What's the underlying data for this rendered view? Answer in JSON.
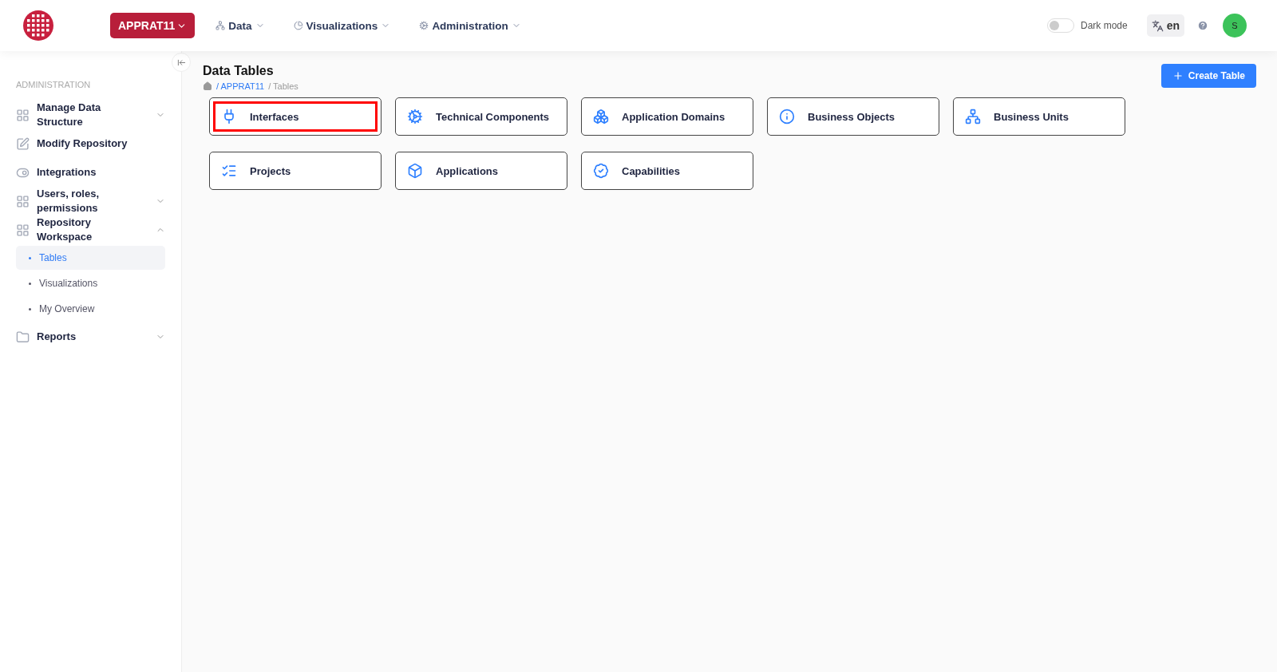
{
  "header": {
    "workspace": "APPRAT11",
    "menus": [
      {
        "label": "Data"
      },
      {
        "label": "Visualizations"
      },
      {
        "label": "Administration"
      }
    ],
    "dark_mode": {
      "label": "Dark mode",
      "on": false
    },
    "language": "en",
    "avatar": "S"
  },
  "sidebar": {
    "section": "ADMINISTRATION",
    "items": [
      {
        "label": "Manage Data Structure",
        "kind": "group",
        "expanded": false
      },
      {
        "label": "Modify Repository",
        "kind": "link"
      },
      {
        "label": "Integrations",
        "kind": "link"
      },
      {
        "label": "Users, roles, permissions",
        "kind": "group",
        "expanded": false
      },
      {
        "label": "Repository Workspace",
        "kind": "group",
        "expanded": true,
        "children": [
          {
            "label": "Tables",
            "selected": true
          },
          {
            "label": "Visualizations",
            "selected": false
          },
          {
            "label": "My Overview",
            "selected": false
          }
        ]
      },
      {
        "label": "Reports",
        "kind": "group",
        "expanded": false
      }
    ]
  },
  "page": {
    "title": "Data Tables",
    "breadcrumb": [
      "/ APPRAT11",
      "/ Tables"
    ],
    "create_button": "Create Table"
  },
  "cards": [
    {
      "label": "Interfaces",
      "highlighted": true
    },
    {
      "label": "Technical Components",
      "highlighted": false
    },
    {
      "label": "Application Domains",
      "highlighted": false
    },
    {
      "label": "Business Objects",
      "highlighted": false
    },
    {
      "label": "Business Units",
      "highlighted": false
    },
    {
      "label": "Projects",
      "highlighted": false
    },
    {
      "label": "Applications",
      "highlighted": false
    },
    {
      "label": "Capabilities",
      "highlighted": false
    }
  ]
}
